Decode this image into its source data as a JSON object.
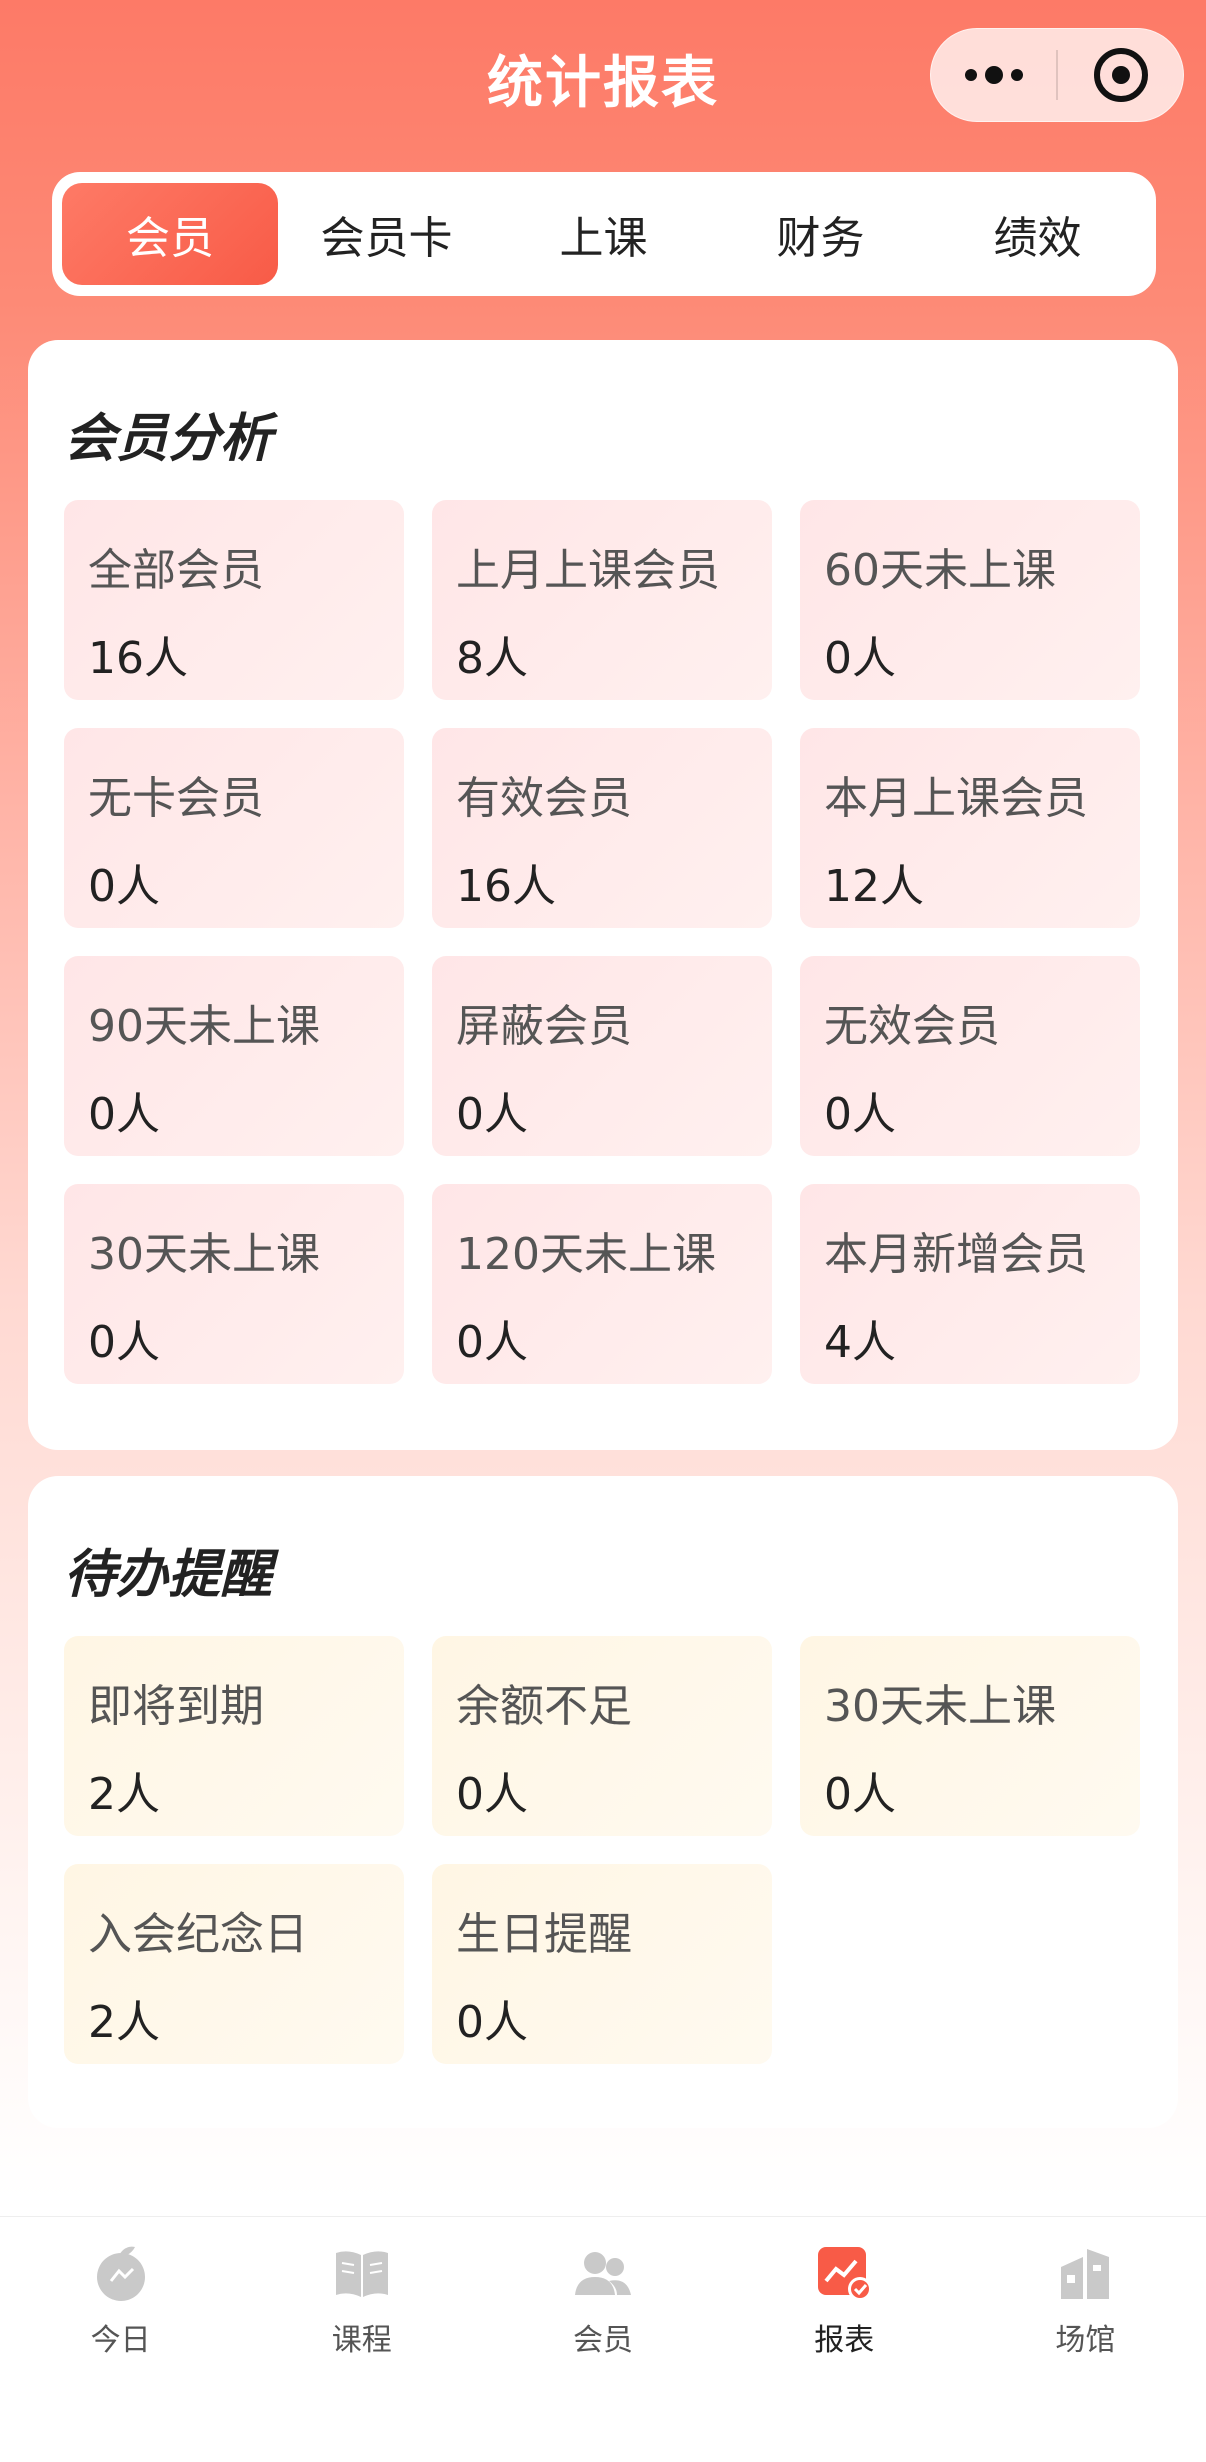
{
  "header": {
    "title": "统计报表"
  },
  "tabs": [
    {
      "label": "会员",
      "active": true
    },
    {
      "label": "会员卡",
      "active": false
    },
    {
      "label": "上课",
      "active": false
    },
    {
      "label": "财务",
      "active": false
    },
    {
      "label": "绩效",
      "active": false
    }
  ],
  "member_analysis": {
    "title": "会员分析",
    "items": [
      {
        "label": "全部会员",
        "value": "16人"
      },
      {
        "label": "上月上课会员",
        "value": "8人"
      },
      {
        "label": "60天未上课",
        "value": "0人"
      },
      {
        "label": "无卡会员",
        "value": "0人"
      },
      {
        "label": "有效会员",
        "value": "16人"
      },
      {
        "label": "本月上课会员",
        "value": "12人"
      },
      {
        "label": "90天未上课",
        "value": "0人"
      },
      {
        "label": "屏蔽会员",
        "value": "0人"
      },
      {
        "label": "无效会员",
        "value": "0人"
      },
      {
        "label": "30天未上课",
        "value": "0人"
      },
      {
        "label": "120天未上课",
        "value": "0人"
      },
      {
        "label": "本月新增会员",
        "value": "4人"
      }
    ]
  },
  "reminders": {
    "title": "待办提醒",
    "items": [
      {
        "label": "即将到期",
        "value": "2人"
      },
      {
        "label": "余额不足",
        "value": "0人"
      },
      {
        "label": "30天未上课",
        "value": "0人"
      },
      {
        "label": "入会纪念日",
        "value": "2人"
      },
      {
        "label": "生日提醒",
        "value": "0人"
      }
    ]
  },
  "bottom_nav": [
    {
      "label": "今日",
      "icon": "today-icon",
      "active": false
    },
    {
      "label": "课程",
      "icon": "book-icon",
      "active": false
    },
    {
      "label": "会员",
      "icon": "members-icon",
      "active": false
    },
    {
      "label": "报表",
      "icon": "report-icon",
      "active": true
    },
    {
      "label": "场馆",
      "icon": "venue-icon",
      "active": false
    }
  ],
  "colors": {
    "accent": "#f85b47",
    "pink_cell": "#ffe6e7",
    "yellow_cell": "#fff6e4"
  }
}
